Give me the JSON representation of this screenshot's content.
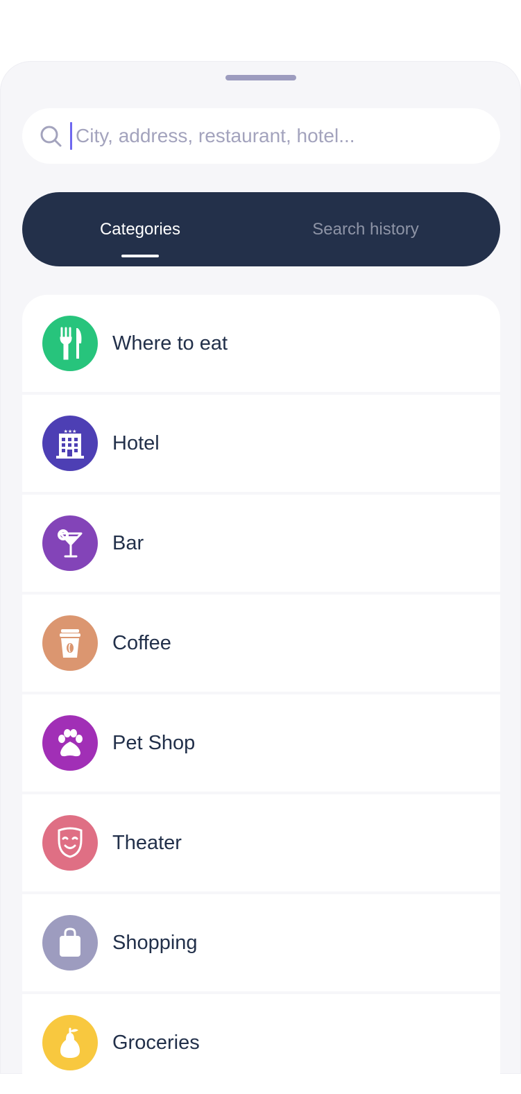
{
  "search": {
    "placeholder": "City, address, restaurant, hotel..."
  },
  "tabs": [
    {
      "label": "Categories",
      "active": true
    },
    {
      "label": "Search history",
      "active": false
    }
  ],
  "categories": [
    {
      "label": "Where to eat",
      "icon": "fork-knife-icon",
      "color": "#27c47c"
    },
    {
      "label": "Hotel",
      "icon": "hotel-building-icon",
      "color": "#4d3fb4"
    },
    {
      "label": "Bar",
      "icon": "cocktail-icon",
      "color": "#8344b8"
    },
    {
      "label": "Coffee",
      "icon": "coffee-cup-icon",
      "color": "#db9670"
    },
    {
      "label": "Pet Shop",
      "icon": "paw-icon",
      "color": "#a12fb6"
    },
    {
      "label": "Theater",
      "icon": "theater-mask-icon",
      "color": "#df6f84"
    },
    {
      "label": "Shopping",
      "icon": "shopping-bag-icon",
      "color": "#9d9cbf"
    },
    {
      "label": "Groceries",
      "icon": "pear-icon",
      "color": "#f8c83f"
    }
  ],
  "colors": {
    "accent": "#6e67f0",
    "tab_bar": "#23304a",
    "text": "#22304a",
    "placeholder": "#a3a3bd"
  }
}
